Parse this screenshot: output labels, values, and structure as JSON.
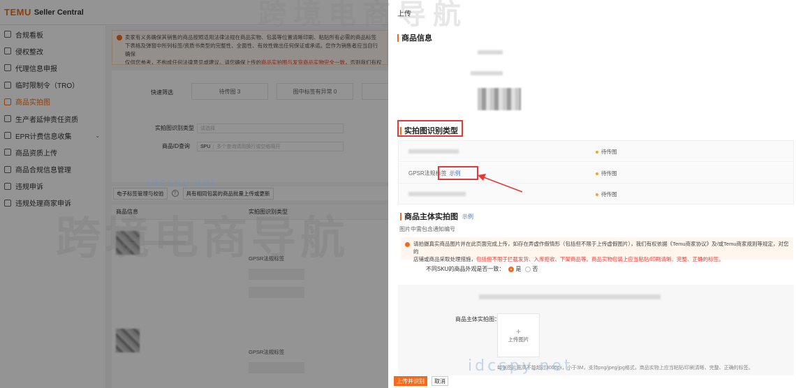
{
  "brand": {
    "logo": "TEMU",
    "sub": "Seller Central"
  },
  "sidebar": {
    "items": [
      {
        "label": "合规看板",
        "icon": "dashboard-icon"
      },
      {
        "label": "侵权整改",
        "icon": "alert-icon"
      },
      {
        "label": "代理信息申报",
        "icon": "user-icon"
      },
      {
        "label": "临时限制令（TRO）",
        "icon": "document-icon"
      },
      {
        "label": "商品实拍图",
        "icon": "image-icon",
        "active": true
      },
      {
        "label": "生产者延伸责任资质",
        "icon": "certificate-icon"
      },
      {
        "label": "EPR计费信息收集",
        "icon": "form-icon",
        "has_chevron": true
      },
      {
        "label": "商品资质上传",
        "icon": "upload-icon"
      },
      {
        "label": "商品合规信息管理",
        "icon": "list-icon"
      },
      {
        "label": "违规申诉",
        "icon": "appeal-icon"
      },
      {
        "label": "违规处理商家申诉",
        "icon": "folder-icon"
      }
    ],
    "chevron": "⌄"
  },
  "background": {
    "notice_line1": "卖家有义务确保其销售的商品按照适用法律法规在商品实物、包装等位置清晰印刷、粘贴所有必需的商品标签",
    "notice_line2": "下表格及弹窗中所列标签/资质书类型的完整性、全面性、有效性做出任何保证或承诺。您作为销售者应当自行确保",
    "notice_line3_a": "仅供您参考，不构成任何法律意见或建议。请您确保上传的",
    "notice_line3_hl": "商品实拍图与发货商品实物完全一致",
    "notice_line3_b": "，否则我们有权依据",
    "quick_filter_label": "快速筛选",
    "chip_pending": "待传图 3",
    "chip_abnormal": "图中标签有异常 0",
    "type_label": "实拍图识别类型",
    "type_placeholder": "请选择",
    "query_label": "商品ID查询",
    "query_tag": "SPU",
    "query_placeholder": "多个查询请用换行或空格隔开",
    "toolbar_btn1": "电子标签管理与校验",
    "toolbar_help": "?",
    "toolbar_btn2": "具有相同包装的商品批量上传或更新",
    "th_goods": "商品信息",
    "th_type": "实拍图识别类型",
    "row1_type": "GPSR法规标签",
    "row2_type": "GPSR法规标签"
  },
  "drawer": {
    "top_title": "上传",
    "section_goods": "商品信息",
    "section_types": "实拍图识别类型",
    "type_rows": [
      {
        "name": "",
        "status": "待传图"
      },
      {
        "name": "GPSR法规标签",
        "demo": "示例",
        "status": "待传图"
      },
      {
        "name": "",
        "status": "待传图"
      }
    ],
    "section_main": "商品主体实拍图",
    "section_main_demo": "示例",
    "main_hint": "图片中需包含通知编号",
    "warn_a": "请拍摄真实商品图片并在此页面完成上传，如存在弄虚作假情形（包括但不限于上传虚假图片），我们有权依据《Temu商家协议》及/或Temu商家规则等规定，对您的",
    "warn_b": "店铺或商品采取处理措施，",
    "warn_hl": "包括但不限于拦截发货、入库拒收、下架商品等。商品实物包装上应当粘贴/印刷清晰、完整、正确的标签。",
    "sku_question": "不同SKU的商品外观是否一致：",
    "opt_yes": "是",
    "opt_no": "否",
    "upload_label": "商品主体实拍图：",
    "upload_plus": "+",
    "upload_text": "上传图片",
    "upload_rule": "每张图片宽高不能超过3000px，小于3M，支持png/jpeg/jpg格式，商品实物上应当粘贴/印刷清晰、完整、正确的标签。",
    "submit": "上传并识别",
    "cancel": "取消"
  },
  "watermark": {
    "cn": "跨境电商导航",
    "domain": "idcspy.net",
    "top": "跨境电商导航"
  },
  "colors": {
    "accent": "#f26b1d",
    "link": "#3a7bd5",
    "highlight": "#e53935"
  }
}
